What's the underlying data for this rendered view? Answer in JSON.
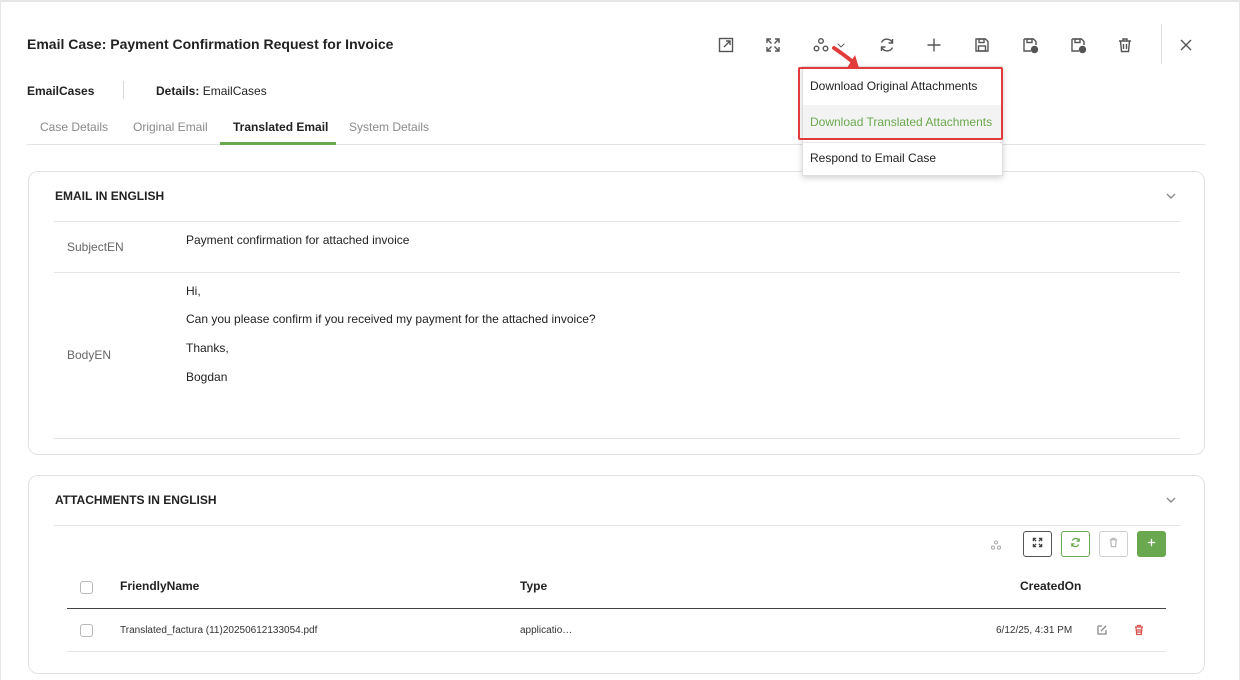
{
  "header": {
    "title": "Email Case: Payment Confirmation Request for Invoice"
  },
  "toolbar": {
    "icons": [
      "open-new-window-icon",
      "expand-icon",
      "workflow-icon",
      "chevron-down-icon",
      "refresh-icon",
      "add-icon",
      "save-icon",
      "save-and-new-icon",
      "save-and-close-icon",
      "delete-icon",
      "close-icon"
    ]
  },
  "breadcrumb": {
    "entity": "EmailCases",
    "details_label": "Details:",
    "details_value": "EmailCases"
  },
  "tabs": [
    {
      "label": "Case Details",
      "active": false
    },
    {
      "label": "Original Email",
      "active": false
    },
    {
      "label": "Translated Email",
      "active": true
    },
    {
      "label": "System Details",
      "active": false
    }
  ],
  "email_section": {
    "title": "EMAIL IN ENGLISH",
    "subject_label": "SubjectEN",
    "subject_value": "Payment confirmation for attached invoice",
    "body_label": "BodyEN",
    "body_lines": [
      "Hi,",
      "Can you please confirm if you received my payment for the attached invoice?",
      "Thanks,",
      "Bogdan"
    ]
  },
  "attachments_section": {
    "title": "ATTACHMENTS IN ENGLISH",
    "columns": [
      "FriendlyName",
      "Type",
      "CreatedOn"
    ],
    "rows": [
      {
        "friendly_name": "Translated_factura (11)20250612133054.pdf",
        "type": "applicatio…",
        "created_on": "6/12/25, 4:31 PM"
      }
    ]
  },
  "dropdown_menu": {
    "items": [
      {
        "label": "Download Original Attachments",
        "highlighted": false
      },
      {
        "label": "Download Translated Attachments",
        "highlighted": true
      },
      {
        "label": "Respond to Email Case",
        "highlighted": false
      }
    ]
  },
  "colors": {
    "accent_green": "#6aa84f",
    "annotation_red": "#e23b3b",
    "delete_red": "#d9534f"
  }
}
